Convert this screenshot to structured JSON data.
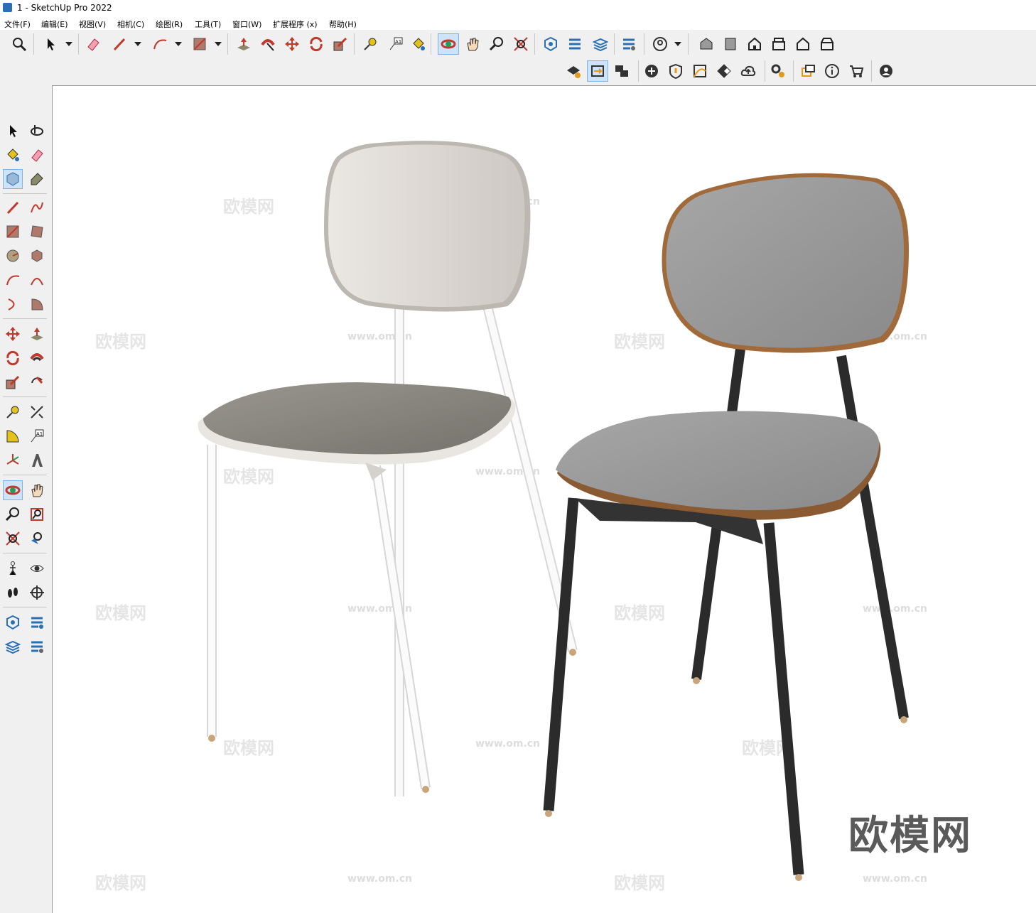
{
  "window": {
    "title": "1 - SketchUp Pro 2022"
  },
  "menu": [
    "文件(F)",
    "编辑(E)",
    "视图(V)",
    "相机(C)",
    "绘图(R)",
    "工具(T)",
    "窗口(W)",
    "扩展程序 (x)",
    "帮助(H)"
  ],
  "watermark": {
    "text": "欧模网",
    "url": "www.om.cn"
  },
  "brand": {
    "text": "欧模网"
  },
  "tools": {
    "top": [
      "zoom-icon",
      "select-icon",
      "eraser-icon",
      "pencil-icon",
      "arc-icon",
      "rectangle-icon",
      "push-pull-icon",
      "follow-me-icon",
      "move-icon",
      "rotate-icon",
      "scale-icon",
      "tape-measure-icon",
      "text-icon",
      "paint-bucket-icon",
      "orbit-icon",
      "pan-icon",
      "zoom-tool-icon",
      "zoom-extents-icon",
      "3d-warehouse-icon",
      "extension-icon",
      "layers-icon",
      "components-icon",
      "account-icon",
      "view-iso-icon",
      "view-top-icon",
      "view-front-icon",
      "view-right-icon",
      "view-back-icon",
      "view-left-icon"
    ],
    "second": [
      "trimble-connect-icon",
      "sync-icon",
      "scenes-icon",
      "add-icon",
      "shield-icon",
      "sandbox-icon",
      "checker-icon",
      "cloud-icon",
      "settings-icon",
      "chat-icon",
      "info-icon",
      "cart-icon",
      "profile-icon"
    ]
  },
  "colors": {
    "accent": "#2a6fb5",
    "active_tool": "#cfe3f8"
  }
}
